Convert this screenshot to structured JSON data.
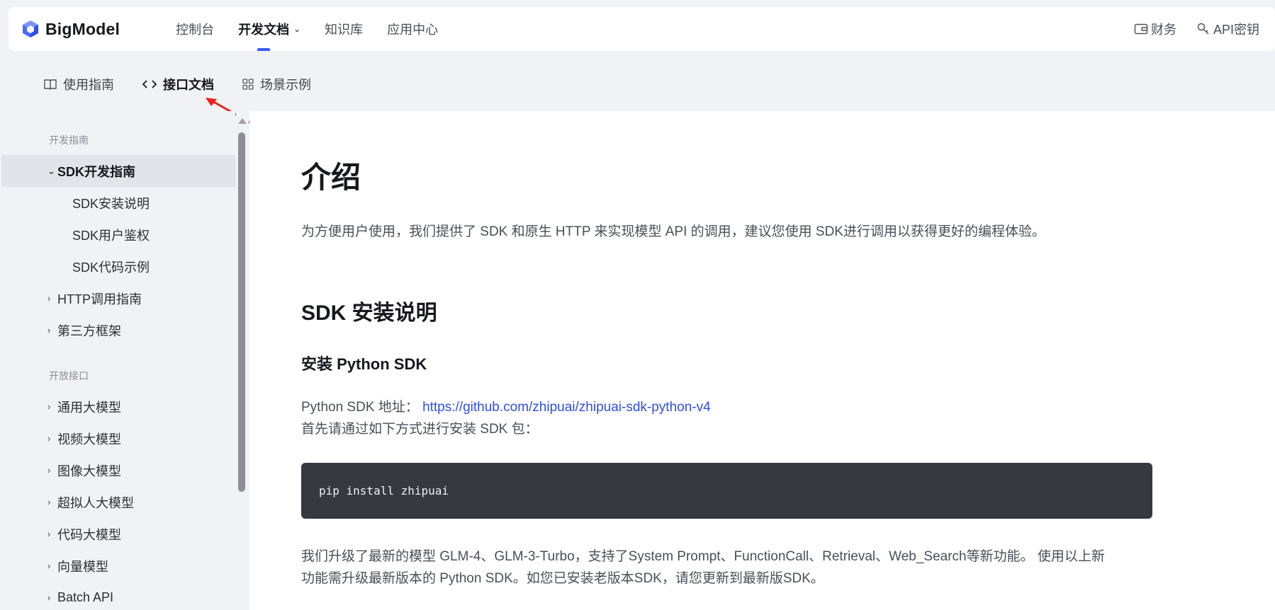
{
  "brand": {
    "name": "BigModel",
    "accent": "#3b5bff"
  },
  "topnav": {
    "items": [
      {
        "label": "控制台"
      },
      {
        "label": "开发文档",
        "active": true
      },
      {
        "label": "知识库"
      },
      {
        "label": "应用中心"
      }
    ],
    "right": [
      {
        "label": "财务",
        "icon": "wallet-icon"
      },
      {
        "label": "API密钥",
        "icon": "key-icon"
      }
    ]
  },
  "subnav": {
    "items": [
      {
        "label": "使用指南",
        "icon": "book-icon"
      },
      {
        "label": "接口文档",
        "icon": "code-icon",
        "active": true
      },
      {
        "label": "场景示例",
        "icon": "grid-icon"
      }
    ]
  },
  "sidebar": {
    "group1": "开发指南",
    "group2": "开放接口",
    "items": [
      {
        "label": "SDK开发指南",
        "expanded": true,
        "active": true
      },
      {
        "label": "SDK安装说明"
      },
      {
        "label": "SDK用户鉴权"
      },
      {
        "label": "SDK代码示例"
      },
      {
        "label": "HTTP调用指南"
      },
      {
        "label": "第三方框架"
      },
      {
        "label": "通用大模型"
      },
      {
        "label": "视频大模型"
      },
      {
        "label": "图像大模型"
      },
      {
        "label": "超拟人大模型"
      },
      {
        "label": "代码大模型"
      },
      {
        "label": "向量模型"
      },
      {
        "label": "Batch API"
      }
    ]
  },
  "main": {
    "title": "介绍",
    "intro": "为方便用户使用，我们提供了 SDK 和原生 HTTP 来实现模型 API 的调用，建议您使用 SDK进行调用以获得更好的编程体验。",
    "section_title": "SDK 安装说明",
    "subsection_title": "安装 Python SDK",
    "sdk_address_label": "Python SDK 地址：",
    "sdk_address_link": "https://github.com/zhipuai/zhipuai-sdk-python-v4",
    "install_hint": "首先请通过如下方式进行安装 SDK 包：",
    "code": "pip install zhipuai",
    "upgrade_line1": "我们升级了最新的模型 GLM-4、GLM-3-Turbo，支持了System Prompt、FunctionCall、Retrieval、Web_Search等新功能。 使用以上新",
    "upgrade_line2": "功能需升级最新版本的 Python SDK。如您已安装老版本SDK，请您更新到最新版SDK。"
  }
}
